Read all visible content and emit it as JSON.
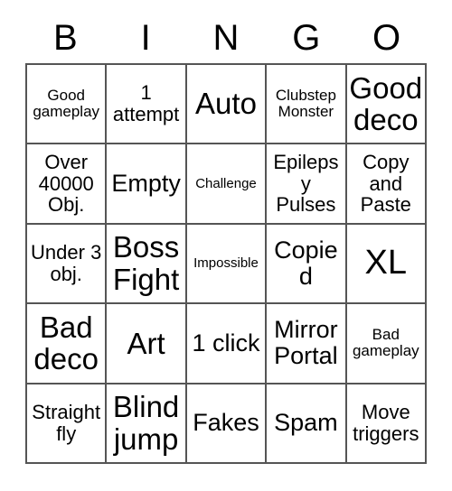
{
  "header": {
    "letters": [
      "B",
      "I",
      "N",
      "G",
      "O"
    ]
  },
  "grid": {
    "columns": 5,
    "rows": 5,
    "border_color": "#555555",
    "background_color": "#ffffff",
    "text_color": "#000000",
    "cells": [
      {
        "text": "Good gameplay",
        "size": "s"
      },
      {
        "text": "1 attempt",
        "size": "m"
      },
      {
        "text": "Auto",
        "size": "xl"
      },
      {
        "text": "Clubstep Monster",
        "size": "s"
      },
      {
        "text": "Good deco",
        "size": "xl"
      },
      {
        "text": "Over 40000 Obj.",
        "size": "m"
      },
      {
        "text": "Empty",
        "size": "l"
      },
      {
        "text": "Challenge",
        "size": "xs"
      },
      {
        "text": "Epilepsy Pulses",
        "size": "m"
      },
      {
        "text": "Copy and Paste",
        "size": "m"
      },
      {
        "text": "Under 3 obj.",
        "size": "m"
      },
      {
        "text": "Boss Fight",
        "size": "xl"
      },
      {
        "text": "Impossible",
        "size": "xs"
      },
      {
        "text": "Copied",
        "size": "l"
      },
      {
        "text": "XL",
        "size": "xxl"
      },
      {
        "text": "Bad deco",
        "size": "xl"
      },
      {
        "text": "Art",
        "size": "xl"
      },
      {
        "text": "1 click",
        "size": "l"
      },
      {
        "text": "Mirror Portal",
        "size": "l"
      },
      {
        "text": "Bad gameplay",
        "size": "s"
      },
      {
        "text": "Straight fly",
        "size": "m"
      },
      {
        "text": "Blind jump",
        "size": "xl"
      },
      {
        "text": "Fakes",
        "size": "l"
      },
      {
        "text": "Spam",
        "size": "l"
      },
      {
        "text": "Move triggers",
        "size": "m"
      }
    ]
  }
}
